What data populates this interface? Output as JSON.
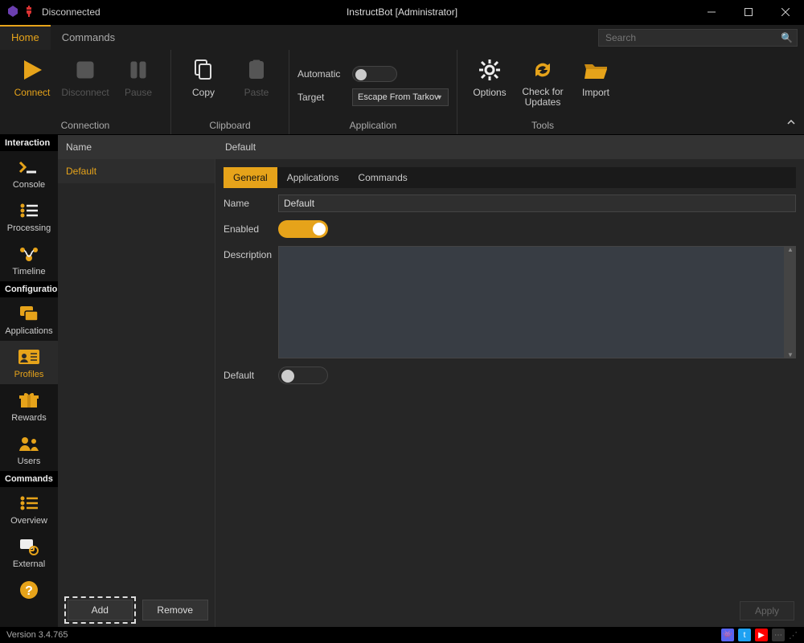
{
  "title": "InstructBot [Administrator]",
  "connection_status": "Disconnected",
  "menus": {
    "home": "Home",
    "commands": "Commands"
  },
  "search": {
    "placeholder": "Search"
  },
  "ribbon": {
    "connection": {
      "label": "Connection",
      "connect": "Connect",
      "disconnect": "Disconnect",
      "pause": "Pause"
    },
    "clipboard": {
      "label": "Clipboard",
      "copy": "Copy",
      "paste": "Paste"
    },
    "application": {
      "label": "Application",
      "automatic": "Automatic",
      "target_label": "Target",
      "target_value": "Escape From Tarkov"
    },
    "tools": {
      "label": "Tools",
      "options": "Options",
      "updates": "Check for Updates",
      "import": "Import"
    }
  },
  "sidebar": {
    "sections": {
      "interaction": "Interaction",
      "configuration": "Configuration",
      "commands": "Commands"
    },
    "items": {
      "console": "Console",
      "processing": "Processing",
      "timeline": "Timeline",
      "applications": "Applications",
      "profiles": "Profiles",
      "rewards": "Rewards",
      "users": "Users",
      "overview": "Overview",
      "external": "External",
      "help": "Help"
    }
  },
  "list": {
    "header": "Name",
    "items": [
      "Default"
    ],
    "add": "Add",
    "remove": "Remove"
  },
  "detail": {
    "header": "Default",
    "tabs": {
      "general": "General",
      "applications": "Applications",
      "commands": "Commands"
    },
    "fields": {
      "name_label": "Name",
      "name_value": "Default",
      "enabled_label": "Enabled",
      "description_label": "Description",
      "default_label": "Default"
    },
    "apply": "Apply"
  },
  "status": {
    "version": "Version 3.4.765"
  },
  "colors": {
    "accent": "#e6a31a"
  }
}
